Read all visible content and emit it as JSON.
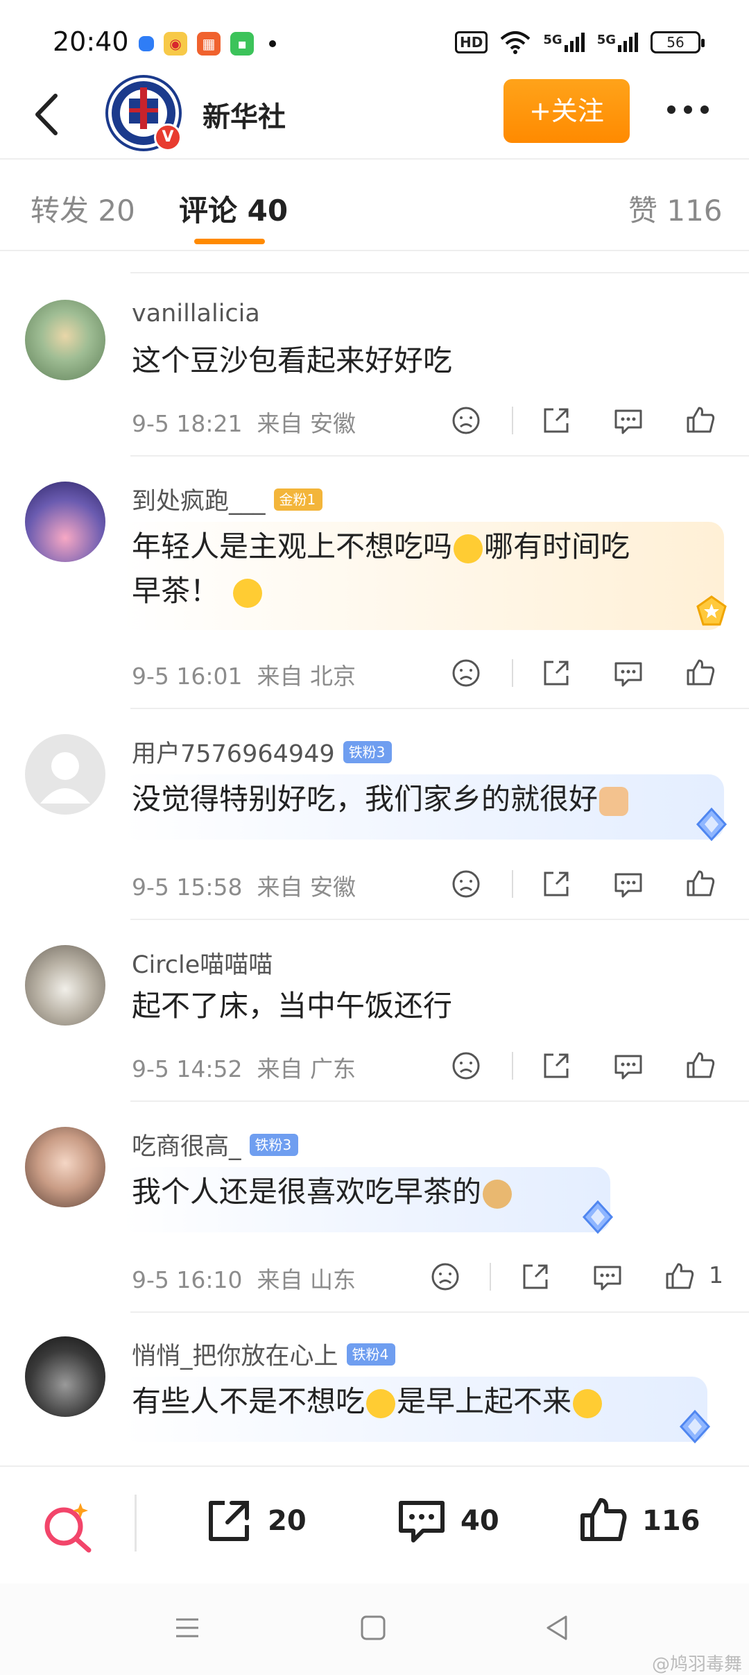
{
  "status_bar": {
    "time": "20:40",
    "network_1": "5G",
    "network_2": "5G",
    "battery": "56",
    "hd_label": "HD"
  },
  "header": {
    "account_name": "新华社",
    "follow_label": "+关注",
    "verified_badge": "V"
  },
  "tabs": [
    {
      "label": "转发 20"
    },
    {
      "label": "评论 40"
    },
    {
      "label": "赞 116"
    }
  ],
  "comments": [
    {
      "user": "vanillalicia",
      "badge": "",
      "text": "这个豆沙包看起来好好吃",
      "time": "9-5 18:21",
      "location": "来自 安徽",
      "likes": ""
    },
    {
      "user": "到处疯跑___",
      "badge": "金粉1",
      "text_line1": "年轻人是主观上不想吃吗",
      "text_line1b": "哪有时间吃",
      "text_line2": "早茶！",
      "time": "9-5 16:01",
      "location": "来自 北京",
      "likes": ""
    },
    {
      "user": "用户7576964949",
      "badge": "铁粉3",
      "text": "没觉得特别好吃，我们家乡的就很好",
      "time": "9-5 15:58",
      "location": "来自 安徽",
      "likes": ""
    },
    {
      "user": "Circle喵喵喵",
      "badge": "",
      "text": "起不了床，当中午饭还行",
      "time": "9-5 14:52",
      "location": "来自 广东",
      "likes": ""
    },
    {
      "user": "吃商很高_",
      "badge": "铁粉3",
      "text": "我个人还是很喜欢吃早茶的",
      "time": "9-5 16:10",
      "location": "来自 山东",
      "likes": "1"
    },
    {
      "user": "悄悄_把你放在心上",
      "badge": "铁粉4",
      "text_a": "有些人不是不想吃",
      "text_b": "是早上起不来",
      "time": "",
      "location": "",
      "likes": ""
    }
  ],
  "bottom_bar": {
    "repost_count": "20",
    "comment_count": "40",
    "like_count": "116"
  },
  "watermark": "@鸠羽毒舞",
  "colors": {
    "accent": "#ff8a00",
    "gold_badge": "#f3b53a",
    "iron_badge": "#6f9ef0",
    "verified_red": "#e83b2f",
    "muted_text": "#8c8c8c"
  }
}
